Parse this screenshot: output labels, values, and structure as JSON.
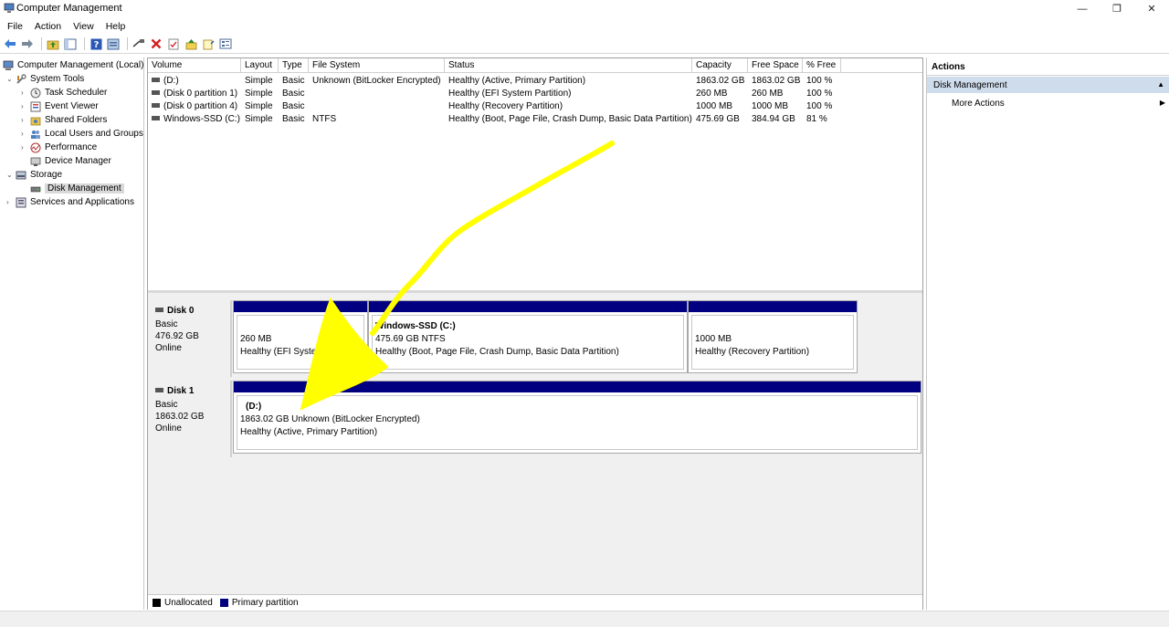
{
  "window": {
    "title": "Computer Management",
    "minimize": "—",
    "restore": "❐",
    "close": "✕"
  },
  "menu": [
    "File",
    "Action",
    "View",
    "Help"
  ],
  "toolbar_icons": [
    "back-arrow-icon",
    "forward-arrow-icon",
    "up-folder-icon",
    "show-tree-icon",
    "help-icon",
    "properties-icon",
    "connect-icon",
    "delete-icon",
    "check-icon",
    "import-icon",
    "export-icon",
    "list-view-icon"
  ],
  "tree": {
    "root": "Computer Management (Local)",
    "system_tools": "System Tools",
    "task_scheduler": "Task Scheduler",
    "event_viewer": "Event Viewer",
    "shared_folders": "Shared Folders",
    "local_users": "Local Users and Groups",
    "performance": "Performance",
    "device_manager": "Device Manager",
    "storage": "Storage",
    "disk_management": "Disk Management",
    "services": "Services and Applications"
  },
  "volume_table": {
    "headers": [
      "Volume",
      "Layout",
      "Type",
      "File System",
      "Status",
      "Capacity",
      "Free Space",
      "% Free"
    ],
    "rows": [
      [
        "(D:)",
        "Simple",
        "Basic",
        "Unknown (BitLocker Encrypted)",
        "Healthy (Active, Primary Partition)",
        "1863.02 GB",
        "1863.02 GB",
        "100 %"
      ],
      [
        "(Disk 0 partition 1)",
        "Simple",
        "Basic",
        "",
        "Healthy (EFI System Partition)",
        "260 MB",
        "260 MB",
        "100 %"
      ],
      [
        "(Disk 0 partition 4)",
        "Simple",
        "Basic",
        "",
        "Healthy (Recovery Partition)",
        "1000 MB",
        "1000 MB",
        "100 %"
      ],
      [
        "Windows-SSD (C:)",
        "Simple",
        "Basic",
        "NTFS",
        "Healthy (Boot, Page File, Crash Dump, Basic Data Partition)",
        "475.69 GB",
        "384.94 GB",
        "81 %"
      ]
    ]
  },
  "disk0": {
    "name": "Disk 0",
    "type": "Basic",
    "size": "476.92 GB",
    "state": "Online",
    "p1_size": "260 MB",
    "p1_status": "Healthy (EFI System Partition)",
    "p2_name": "Windows-SSD  (C:)",
    "p2_size": "475.69 GB NTFS",
    "p2_status": "Healthy (Boot, Page File, Crash Dump, Basic Data Partition)",
    "p3_size": "1000 MB",
    "p3_status": "Healthy (Recovery Partition)"
  },
  "disk1": {
    "name": "Disk 1",
    "type": "Basic",
    "size": "1863.02 GB",
    "state": "Online",
    "p1_name": "(D:)",
    "p1_size": "1863.02 GB Unknown (BitLocker Encrypted)",
    "p1_status": "Healthy (Active, Primary Partition)"
  },
  "legend": {
    "unallocated": "Unallocated",
    "unallocated_color": "#000000",
    "primary": "Primary partition",
    "primary_color": "#000080"
  },
  "actions": {
    "header": "Actions",
    "section": "Disk Management",
    "more": "More Actions"
  },
  "annotation": {
    "color": "#ffff00",
    "icon": "yellow-arrow-annotation"
  }
}
